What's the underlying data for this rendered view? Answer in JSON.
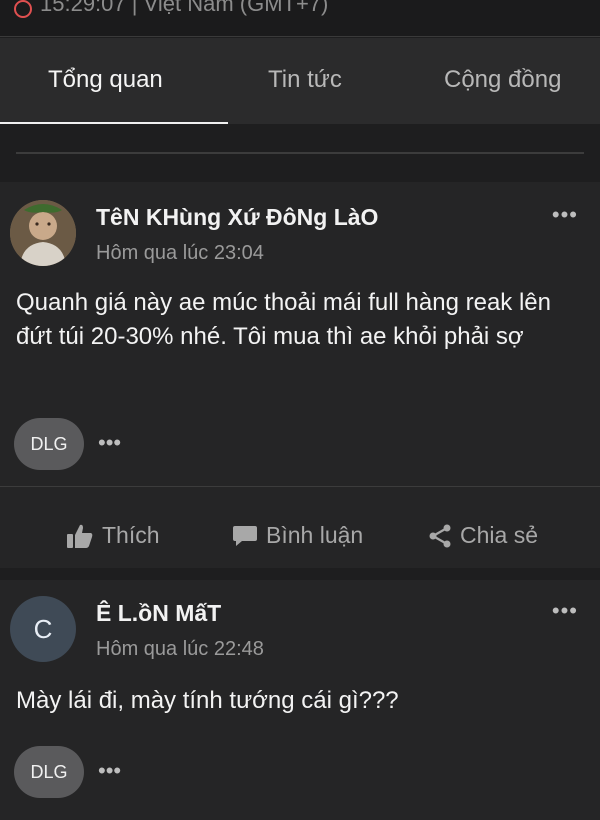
{
  "status": {
    "clock_text": "15:29:07 | Việt Nam (GMT+7)"
  },
  "tabs": [
    {
      "label": "Tổng quan",
      "active": true
    },
    {
      "label": "Tin tức",
      "active": false
    },
    {
      "label": "Cộng đồng",
      "active": false
    }
  ],
  "posts": [
    {
      "author": "TêN KHùng Xứ ĐôNg LàO",
      "time": "Hôm qua lúc 23:04",
      "text": "Quanh giá này ae múc thoải mái full hàng reak lên đứt túi 20-30% nhé. Tôi mua thì ae khỏi phải sợ",
      "tag": "DLG",
      "more": "•••"
    },
    {
      "author": "Ê L.ồN MấT",
      "avatar_letter": "C",
      "time": "Hôm qua lúc 22:48",
      "text": "Mày lái đi, mày tính tướng cái gì???",
      "tag": "DLG",
      "more": "•••"
    }
  ],
  "actions": {
    "like": "Thích",
    "comment": "Bình luận",
    "share": "Chia sẻ"
  },
  "menu_dots": "•••",
  "colors": {
    "background": "#1e1e1f",
    "card": "#252526",
    "tabbar": "#2b2b2c"
  }
}
